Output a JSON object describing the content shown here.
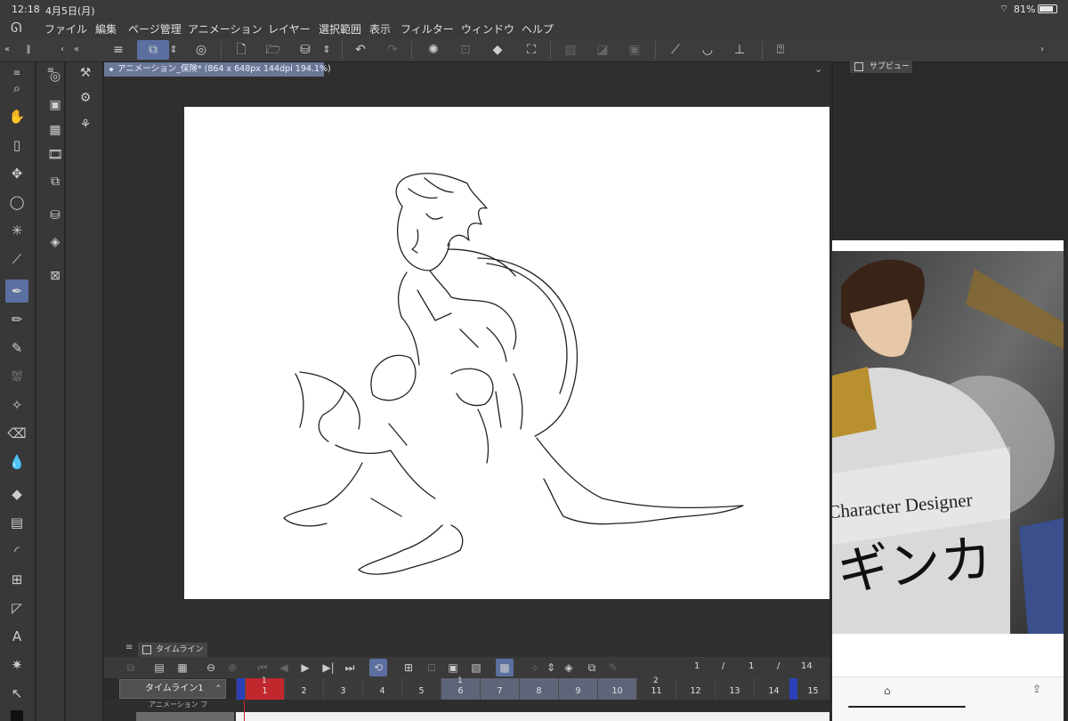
{
  "status": {
    "time": "12:18",
    "date": "4月5日(月)",
    "battery": "81%"
  },
  "menu": [
    "ファイル",
    "編集",
    "ページ管理",
    "アニメーション",
    "レイヤー",
    "選択範囲",
    "表示",
    "フィルター",
    "ウィンドウ",
    "ヘルプ"
  ],
  "document": {
    "tab_label": "アニメーション_保険* (864 x 648px 144dpi 194.1%)"
  },
  "sub_view": {
    "tab_label": "サブビュー",
    "preview_text_en": "Character Designer",
    "preview_text_jp": "ギンカ"
  },
  "timeline": {
    "tab_label": "タイムライン",
    "name": "タイムライン1",
    "counter_current": "1",
    "counter_sep": "/",
    "counter_a": "1",
    "counter_b": "14",
    "frames": [
      "1",
      "2",
      "3",
      "4",
      "5",
      "6",
      "7",
      "8",
      "9",
      "10",
      "11",
      "12",
      "13",
      "14",
      "15"
    ],
    "second_marks": [
      "1",
      "1",
      "2"
    ],
    "track_label": "アニメーション フ"
  },
  "colors": {
    "accent": "#5b6fa0",
    "playhead": "#c0282e",
    "range": "#5f6579",
    "marker": "#2a3fb8"
  }
}
